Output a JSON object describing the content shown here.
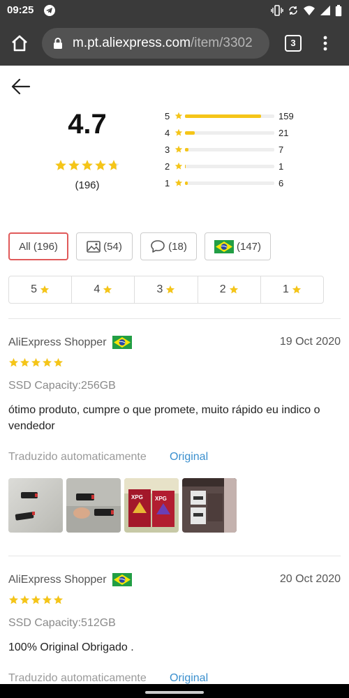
{
  "status_bar": {
    "time": "09:25"
  },
  "browser": {
    "url_domain": "m.pt.aliexpress.com",
    "url_path": "/item/3302",
    "tab_count": "3"
  },
  "summary": {
    "average": "4.7",
    "average_stars": 4.7,
    "total": "(196)",
    "distribution": [
      {
        "stars": "5",
        "count": "159",
        "fraction": 0.85
      },
      {
        "stars": "4",
        "count": "21",
        "fraction": 0.11
      },
      {
        "stars": "3",
        "count": "7",
        "fraction": 0.04
      },
      {
        "stars": "2",
        "count": "1",
        "fraction": 0.01
      },
      {
        "stars": "1",
        "count": "6",
        "fraction": 0.03
      }
    ]
  },
  "filters": {
    "all": "All (196)",
    "photos": "(54)",
    "comments": "(18)",
    "country": "(147)"
  },
  "star_filters": [
    "5",
    "4",
    "3",
    "2",
    "1"
  ],
  "reviews": [
    {
      "author": "AliExpress Shopper",
      "date": "19 Oct 2020",
      "rating": 5,
      "sku": "SSD Capacity:256GB",
      "text": "ótimo produto, cumpre o que promete, muito rápido eu indico o vendedor",
      "translated_label": "Traduzido automaticamente",
      "original_label": "Original",
      "photo_count": 4
    },
    {
      "author": "AliExpress Shopper",
      "date": "20 Oct 2020",
      "rating": 5,
      "sku": "SSD Capacity:512GB",
      "text": "100% Original Obrigado .",
      "translated_label": "Traduzido automaticamente",
      "original_label": "Original",
      "photo_count": 0
    }
  ],
  "colors": {
    "star": "#f5c518",
    "active_chip": "#e05a5a",
    "link": "#3a8fce",
    "browser_bar": "#3a3a3a"
  }
}
